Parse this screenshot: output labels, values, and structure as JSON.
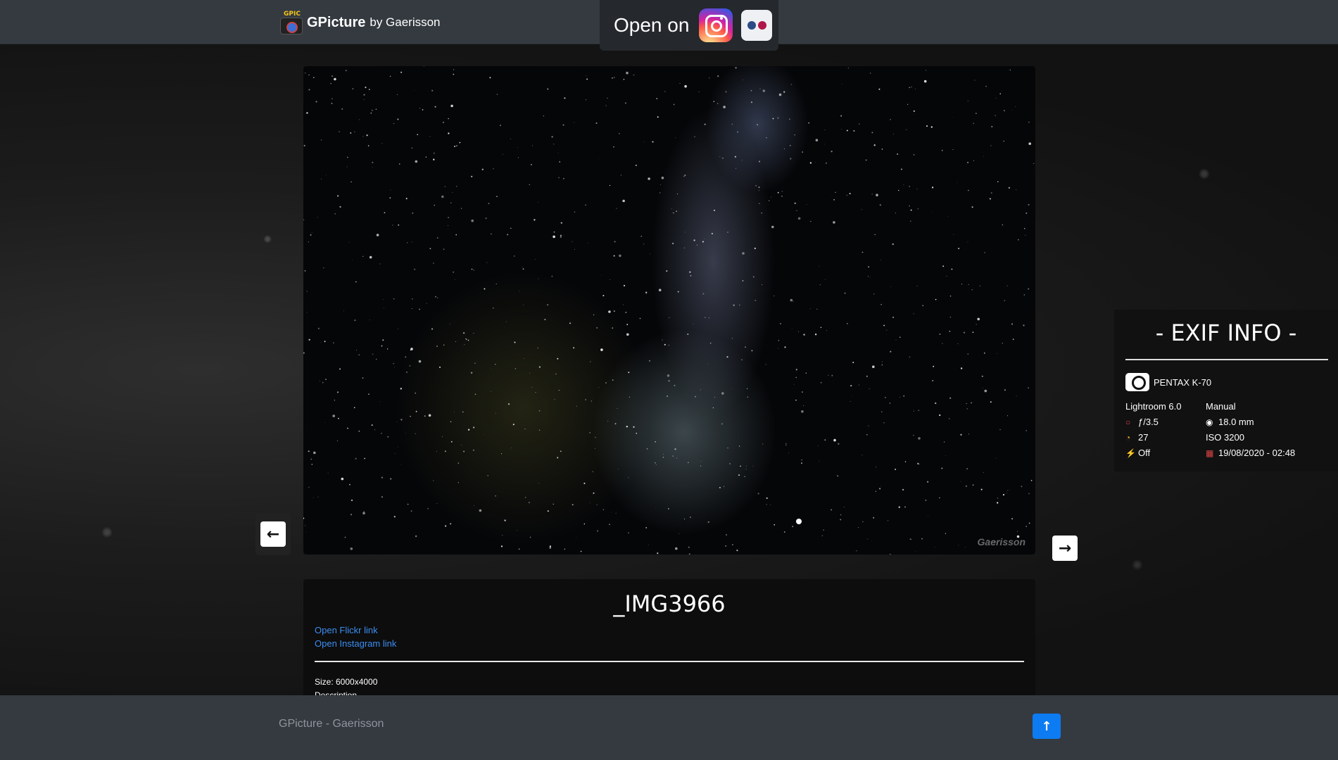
{
  "brand": {
    "logo_tag": "GPIC",
    "name": "GPicture",
    "by": "by Gaerisson"
  },
  "open_on": {
    "label": "Open on",
    "instagram_icon": "instagram-icon",
    "flickr_icon": "flickr-icon"
  },
  "photo": {
    "watermark": "Gaerisson"
  },
  "nav": {
    "prev_glyph": "←",
    "next_glyph": "→"
  },
  "exif": {
    "title": "- EXIF INFO -",
    "camera": "PENTAX K-70",
    "software": "Lightroom 6.0",
    "mode": "Manual",
    "aperture": "ƒ/3.5",
    "focal_length": "18.0 mm",
    "exposure": "27",
    "iso": "ISO 3200",
    "flash": "Off",
    "date": "19/08/2020 - 02:48"
  },
  "info": {
    "title": "_IMG3966",
    "flickr_link": "Open Flickr link",
    "instagram_link": "Open Instagram link",
    "size": "Size: 6000x4000",
    "description": "Description"
  },
  "footer": {
    "text": "GPicture - Gaerisson",
    "top_glyph": "↑"
  },
  "colors": {
    "header": "#343a40",
    "accent": "#0d7cf2",
    "link": "#3b8ef0"
  }
}
